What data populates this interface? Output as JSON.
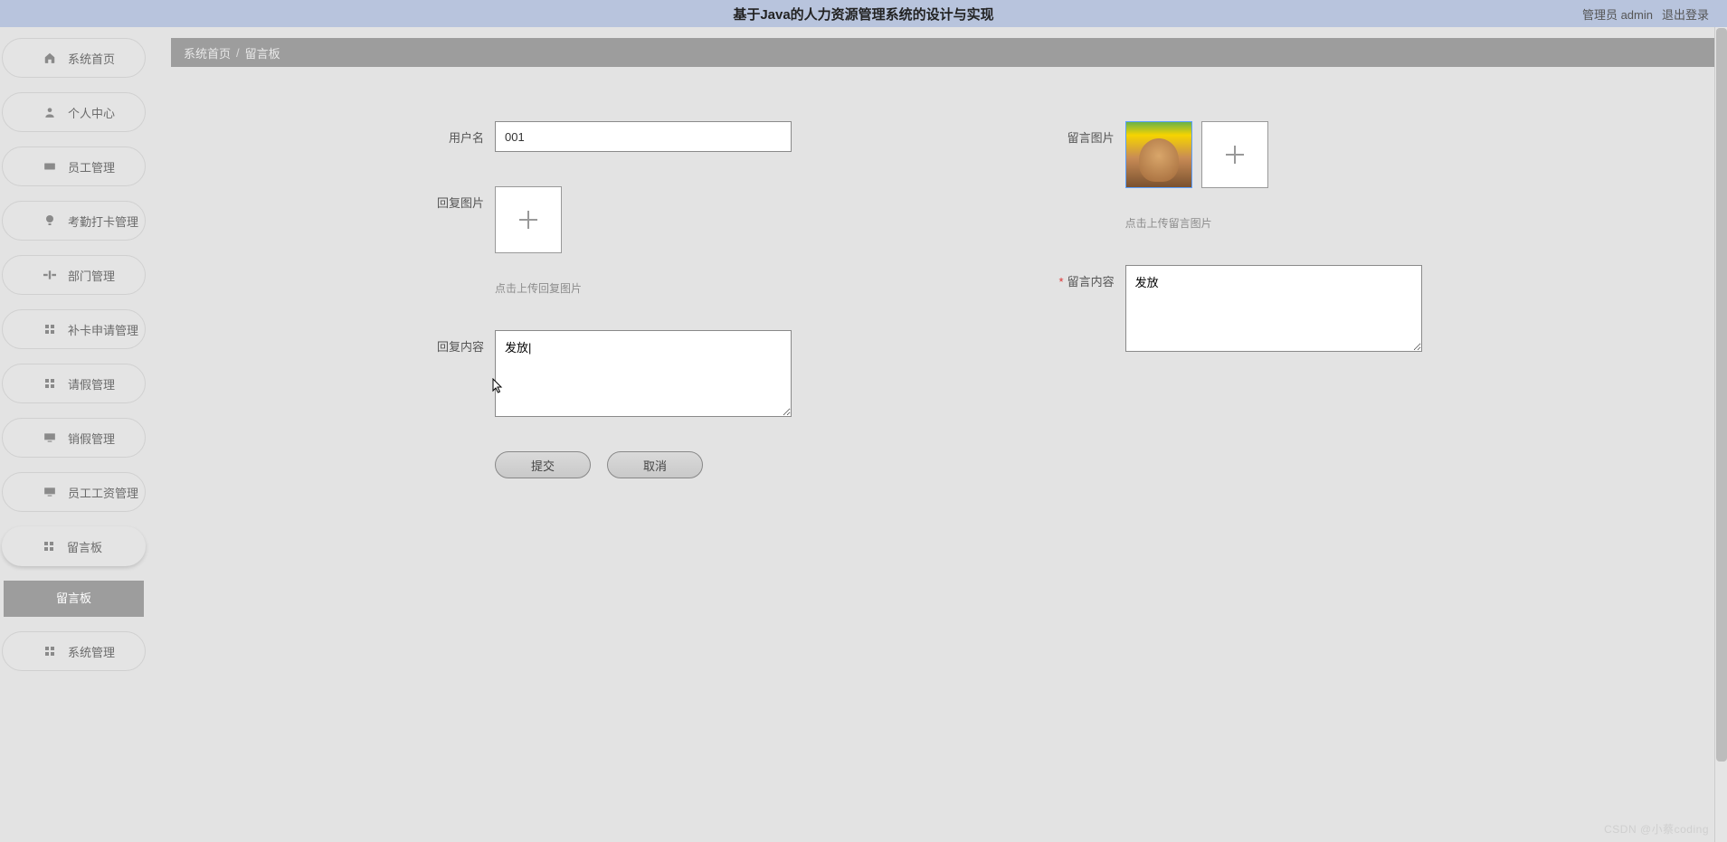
{
  "header": {
    "title": "基于Java的人力资源管理系统的设计与实现",
    "userRole": "管理员 admin",
    "logout": "退出登录"
  },
  "sidebar": {
    "items": [
      {
        "label": "系统首页"
      },
      {
        "label": "个人中心"
      },
      {
        "label": "员工管理"
      },
      {
        "label": "考勤打卡管理"
      },
      {
        "label": "部门管理"
      },
      {
        "label": "补卡申请管理"
      },
      {
        "label": "请假管理"
      },
      {
        "label": "销假管理"
      },
      {
        "label": "员工工资管理"
      },
      {
        "label": "留言板"
      },
      {
        "label": "系统管理"
      }
    ],
    "subItem": "留言板"
  },
  "breadcrumb": {
    "home": "系统首页",
    "sep": "/",
    "current": "留言板"
  },
  "form": {
    "username": {
      "label": "用户名",
      "value": "001"
    },
    "messageImage": {
      "label": "留言图片",
      "hint": "点击上传留言图片"
    },
    "replyImage": {
      "label": "回复图片",
      "hint": "点击上传回复图片"
    },
    "messageContent": {
      "label": "留言内容",
      "value": "发放"
    },
    "replyContent": {
      "label": "回复内容",
      "value": "发放|"
    },
    "buttons": {
      "submit": "提交",
      "cancel": "取消"
    }
  },
  "watermark": "CSDN @小蔡coding"
}
